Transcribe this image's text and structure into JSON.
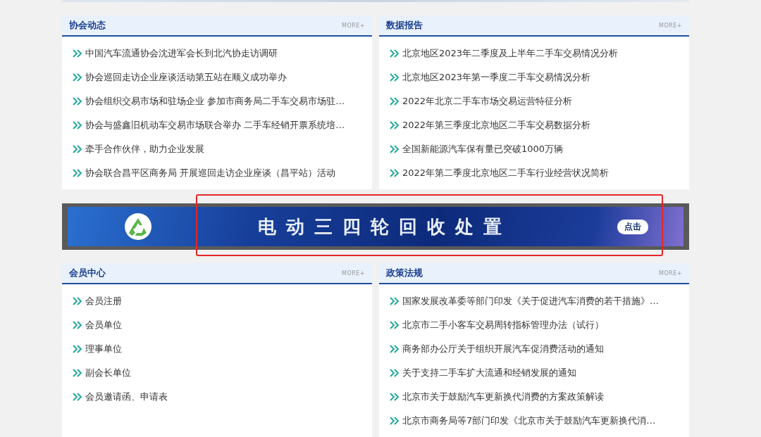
{
  "top_panels": [
    {
      "title": "协会动态",
      "more": "MORE+",
      "items": [
        "中国汽车流通协会沈进军会长到北汽协走访调研",
        "协会巡回走访企业座谈活动第五站在顺义成功举办",
        "协会组织交易市场和驻场企业 参加市商务局二手车交易市场驻…",
        "协会与盛鑫旧机动车交易市场联合举办 二手车经销开票系统培…",
        "牵手合作伙伴，助力企业发展",
        "协会联合昌平区商务局 开展巡回走访企业座谈（昌平站）活动"
      ]
    },
    {
      "title": "数据报告",
      "more": "MORE+",
      "items": [
        "北京地区2023年二季度及上半年二手车交易情况分析",
        "北京地区2023年第一季度二手车交易情况分析",
        "2022年北京二手车市场交易运营特征分析",
        "2022年第三季度北京地区二手车交易数据分析",
        "全国新能源汽车保有量已突破1000万辆",
        "2022年第二季度北京地区二手车行业经营状况简析"
      ]
    }
  ],
  "banner": {
    "title": "电动三四轮回收处置",
    "button": "点击"
  },
  "bottom_panels": [
    {
      "title": "会员中心",
      "more": "MORE+",
      "items": [
        "会员注册",
        "会员单位",
        "理事单位",
        "副会长单位",
        "会员邀请函、申请表"
      ]
    },
    {
      "title": "政策法规",
      "more": "MORE+",
      "items": [
        "国家发展改革委等部门印发《关于促进汽车消费的若干措施》…",
        "北京市二手小客车交易周转指标管理办法（试行）",
        "商务部办公厅关于组织开展汽车促消费活动的通知",
        "关于支持二手车扩大流通和经销发展的通知",
        "北京市关于鼓励汽车更新换代消费的方案政策解读",
        "北京市商务局等7部门印发《北京市关于鼓励汽车更新换代消…"
      ]
    }
  ]
}
